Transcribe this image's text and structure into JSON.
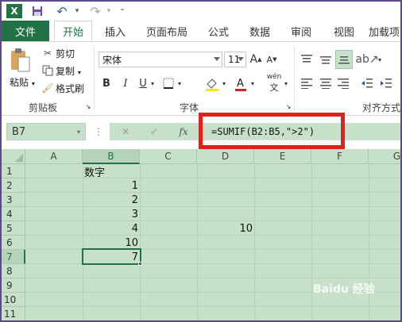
{
  "titlebar": {
    "excel_icon_text": "X",
    "undo_label": "↶",
    "redo_label": "↷"
  },
  "tabs": {
    "file": "文件",
    "items": [
      "开始",
      "插入",
      "页面布局",
      "公式",
      "数据",
      "审阅",
      "视图",
      "加载项"
    ]
  },
  "ribbon": {
    "clipboard": {
      "paste": "粘贴",
      "cut": "剪切",
      "copy": "复制",
      "format_painter": "格式刷",
      "group": "剪贴板"
    },
    "font": {
      "name": "宋体",
      "size": "11",
      "bold": "B",
      "italic": "I",
      "underline": "U",
      "pinyin": "wén",
      "group": "字体",
      "grow": "A",
      "shrink": "A"
    },
    "align": {
      "group": "对齐方式"
    }
  },
  "formula_bar": {
    "name_box": "B7",
    "cancel": "✕",
    "enter": "✓",
    "fx": "fx",
    "formula": "=SUMIF(B2:B5,\">2\")"
  },
  "grid": {
    "columns": [
      "A",
      "B",
      "C",
      "D",
      "E",
      "F",
      "G"
    ],
    "rows": [
      "1",
      "2",
      "3",
      "4",
      "5",
      "6",
      "7",
      "8",
      "9",
      "10",
      "11"
    ],
    "cells": {
      "B1": "数字",
      "B2": "1",
      "B3": "2",
      "B4": "3",
      "B5": "4",
      "B6": "10",
      "B7": "7",
      "D5": "10"
    },
    "selected": "B7"
  },
  "colors": {
    "accent": "#217346",
    "sheet_bg": "#c6e0c9",
    "highlight_box": "#e0201b"
  }
}
